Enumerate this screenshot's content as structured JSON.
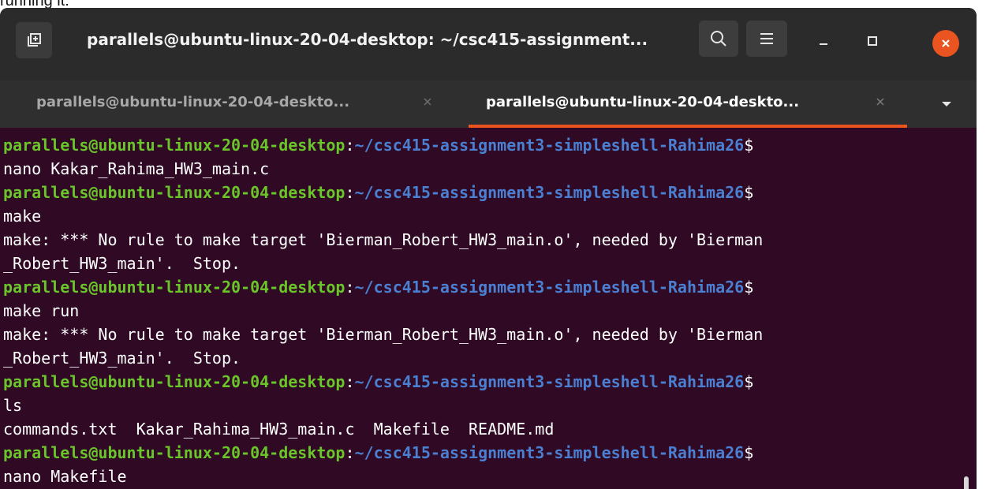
{
  "caption": "running it:",
  "window": {
    "title": "parallels@ubuntu-linux-20-04-desktop: ~/csc415-assignment..."
  },
  "tabs": [
    {
      "label": "parallels@ubuntu-linux-20-04-deskto...",
      "active": false
    },
    {
      "label": "parallels@ubuntu-linux-20-04-deskto...",
      "active": true
    }
  ],
  "colors": {
    "terminal_bg": "#300a24",
    "prompt_user": "#6ac52a",
    "prompt_path": "#4a7fd1",
    "accent": "#e95420"
  },
  "prompt": {
    "user_host": "parallels@ubuntu-linux-20-04-desktop",
    "path": "~/csc415-assignment3-simpleshell-Rahima26",
    "dollar": "$"
  },
  "terminal": {
    "lines": [
      {
        "type": "prompt"
      },
      {
        "type": "text",
        "text": "nano Kakar_Rahima_HW3_main.c"
      },
      {
        "type": "prompt"
      },
      {
        "type": "text",
        "text": "make"
      },
      {
        "type": "text",
        "text": "make: *** No rule to make target 'Bierman_Robert_HW3_main.o', needed by 'Bierman"
      },
      {
        "type": "text",
        "text": "_Robert_HW3_main'.  Stop."
      },
      {
        "type": "prompt"
      },
      {
        "type": "text",
        "text": "make run"
      },
      {
        "type": "text",
        "text": "make: *** No rule to make target 'Bierman_Robert_HW3_main.o', needed by 'Bierman"
      },
      {
        "type": "text",
        "text": "_Robert_HW3_main'.  Stop."
      },
      {
        "type": "prompt"
      },
      {
        "type": "text",
        "text": "ls"
      },
      {
        "type": "text",
        "text": "commands.txt  Kakar_Rahima_HW3_main.c  Makefile  README.md"
      },
      {
        "type": "prompt"
      },
      {
        "type": "text",
        "text": "nano Makefile"
      }
    ]
  },
  "icons": {
    "new_tab": "new-tab-icon",
    "search": "search-icon",
    "menu": "hamburger-menu-icon",
    "minimize": "minimize-icon",
    "maximize": "maximize-icon",
    "close": "close-icon",
    "tab_close": "tab-close-icon",
    "tab_dropdown": "chevron-down-icon"
  }
}
